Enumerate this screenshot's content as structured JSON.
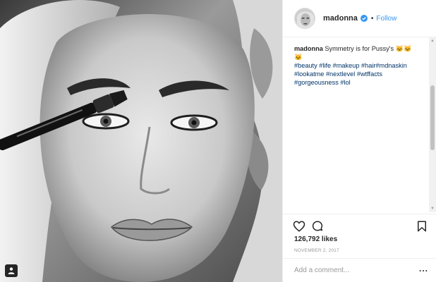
{
  "post": {
    "photo_alt": "Black and white close-up portrait holding a makeup brush",
    "account": {
      "username": "madonna",
      "verified": true,
      "separator": "•",
      "follow_label": "Follow"
    },
    "caption": {
      "username": "madonna",
      "text": "Symmetry is for Pussy's 🐱🐱🐱",
      "hashtags": "#beauty #life #makeup #hair#mdnaskin #lookatme #nextlevel #wtffacts #gorgeousness #lol"
    },
    "likes": "126,792 likes",
    "date": "NOVEMBER 2, 2017",
    "comment": {
      "placeholder": "Add a comment...",
      "more_label": "..."
    }
  },
  "icons": {
    "heart": "heart-icon",
    "comment": "comment-icon",
    "bookmark": "bookmark-icon",
    "tag": "user-tag-icon",
    "verified": "verified-badge-icon"
  },
  "colors": {
    "link_blue": "#3897f0",
    "hashtag_blue": "#003569",
    "text": "#262626",
    "muted": "#999999",
    "border": "#efefef"
  }
}
